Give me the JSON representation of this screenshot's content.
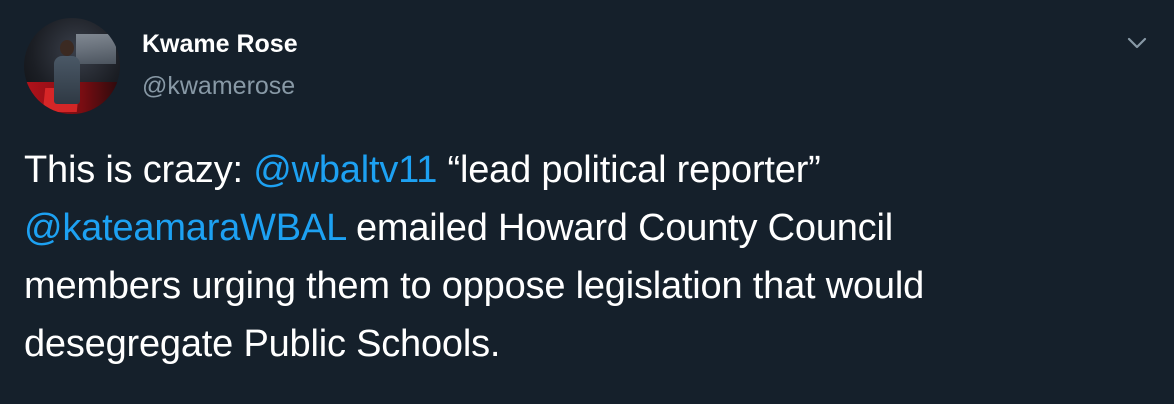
{
  "user": {
    "name": "Kwame Rose",
    "handle": "@kwamerose"
  },
  "tweet": {
    "line1_prefix": "This is crazy: ",
    "mention1": "@wbaltv11",
    "line1_suffix": " “lead political reporter”",
    "mention2": "@kateamaraWBAL",
    "line2_suffix": " emailed Howard County Council",
    "line3": "members urging them to oppose legislation that would",
    "line4": "desegregate Public Schools."
  },
  "icons": {
    "more_menu": "chevron-down-icon"
  },
  "colors": {
    "background": "#15202b",
    "text": "#ffffff",
    "secondary_text": "#8899a6",
    "link": "#1da1f2"
  }
}
